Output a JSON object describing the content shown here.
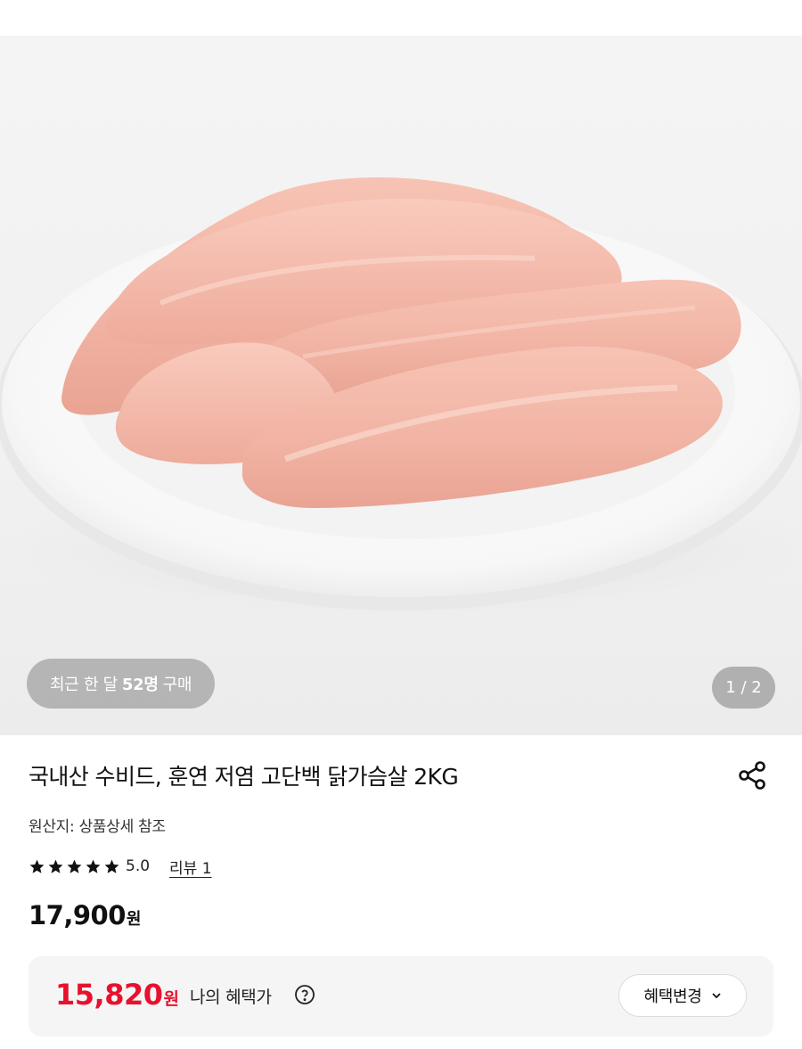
{
  "gallery": {
    "image_name": "chicken-breast-on-plate",
    "recent_purchase": {
      "prefix": "최근 한 달",
      "count": "52명",
      "suffix": "구매"
    },
    "page_indicator": "1 / 2"
  },
  "product": {
    "title": "국내산 수비드, 훈연 저염 고단백 닭가슴살 2KG",
    "origin": "원산지: 상품상세 참조",
    "rating": {
      "stars": 5,
      "score": "5.0",
      "review_link": "리뷰 1"
    },
    "price": {
      "value": "17,900",
      "unit": "원"
    }
  },
  "benefit": {
    "price": "15,820",
    "unit": "원",
    "label": "나의 혜택가",
    "change_button": "혜택변경"
  },
  "colors": {
    "accent_red": "#e8112d",
    "star": "#111111"
  },
  "icons": [
    "share-icon",
    "star-icon",
    "help-circle-icon",
    "chevron-down-icon"
  ]
}
